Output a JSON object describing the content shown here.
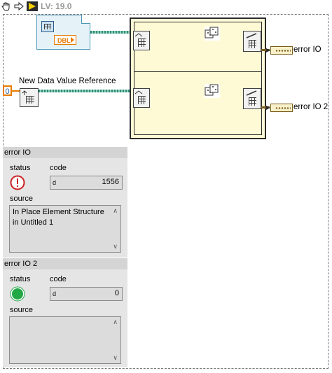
{
  "toolbar": {
    "version_label": "LV: 19.0",
    "icons": [
      "hand-tool-icon",
      "step-arrow-icon",
      "run-icon"
    ]
  },
  "diagram": {
    "class_constant": {
      "type_label": "DBL"
    },
    "numeric_constant": {
      "value": "0"
    },
    "new_dvr_label": "New Data Value Reference",
    "indicators": [
      {
        "label": "error IO"
      },
      {
        "label": "error IO 2"
      }
    ]
  },
  "front_panel": {
    "clusters": [
      {
        "title": "error IO",
        "status_label": "status",
        "code_label": "code",
        "radix": "d",
        "code_value": "1556",
        "source_label": "source",
        "source_text": "In Place Element Structure in Untitled 1",
        "status_state": "error",
        "status_color": "#cc2222"
      },
      {
        "title": "error IO 2",
        "status_label": "status",
        "code_label": "code",
        "radix": "d",
        "code_value": "0",
        "source_label": "source",
        "source_text": "",
        "status_state": "ok",
        "status_color": "#22a845"
      }
    ]
  },
  "colors": {
    "structure_fill": "#fefad6",
    "class_wire": "#2f8c78",
    "numeric_wire": "#e87a00",
    "error_wire": "#7a5c1d"
  }
}
